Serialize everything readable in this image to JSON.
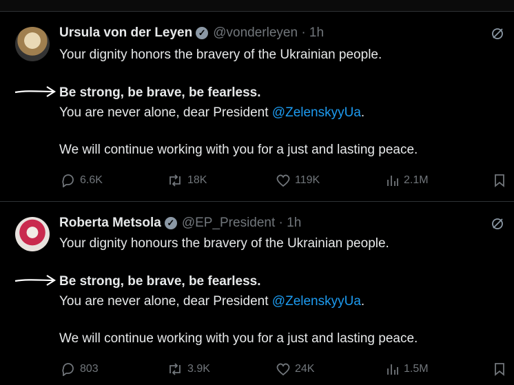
{
  "tweets": [
    {
      "name": "Ursula von der Leyen",
      "handle": "@vonderleyen · 1h",
      "line1": "Your dignity honors the bravery of the Ukrainian people.",
      "line2": "Be strong, be brave, be fearless.",
      "line3_prefix": "You are never alone, dear President ",
      "mention": "@ZelenskyyUa",
      "line3_suffix": ".",
      "line4": "We will continue working with you for a just and lasting peace.",
      "replies": "6.6K",
      "reposts": "18K",
      "likes": "119K",
      "views": "2.1M"
    },
    {
      "name": "Roberta Metsola",
      "handle": "@EP_President · 1h",
      "line1": "Your dignity honours the bravery of the Ukrainian people.",
      "line2": "Be strong, be brave, be fearless.",
      "line3_prefix": "You are never alone, dear President ",
      "mention": "@ZelenskyyUa",
      "line3_suffix": ".",
      "line4": "We will continue working with you for a just and lasting peace.",
      "replies": "803",
      "reposts": "3.9K",
      "likes": "24K",
      "views": "1.5M"
    }
  ],
  "colors": {
    "background": "#000000",
    "text": "#e7e9ea",
    "secondary": "#71767b",
    "link": "#1d9bf0",
    "divider": "#2f3336"
  }
}
